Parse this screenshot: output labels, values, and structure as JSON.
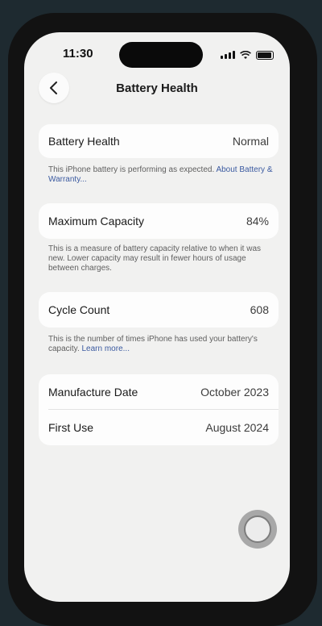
{
  "status_bar": {
    "time": "11:30"
  },
  "nav": {
    "title": "Battery Health",
    "back_icon": "chevron-left-icon"
  },
  "battery_health": {
    "label": "Battery Health",
    "value": "Normal"
  },
  "battery_health_note": {
    "text": "This iPhone battery is performing as expected. ",
    "link": "About Battery & Warranty..."
  },
  "maximum_capacity": {
    "label": "Maximum Capacity",
    "value": "84%"
  },
  "maximum_capacity_note": {
    "text": "This is a measure of battery capacity relative to when it was new. Lower capacity may result in fewer hours of usage between charges."
  },
  "cycle_count": {
    "label": "Cycle Count",
    "value": "608"
  },
  "cycle_count_note": {
    "text": "This is the number of times iPhone has used your battery's capacity. ",
    "link": "Learn more..."
  },
  "dates": {
    "manufacture_label": "Manufacture Date",
    "manufacture_value": "October 2023",
    "first_use_label": "First Use",
    "first_use_value": "August 2024"
  },
  "colors": {
    "link": "#3b5aa0",
    "background": "#f1f1f0",
    "card": "#fdfdfd"
  }
}
